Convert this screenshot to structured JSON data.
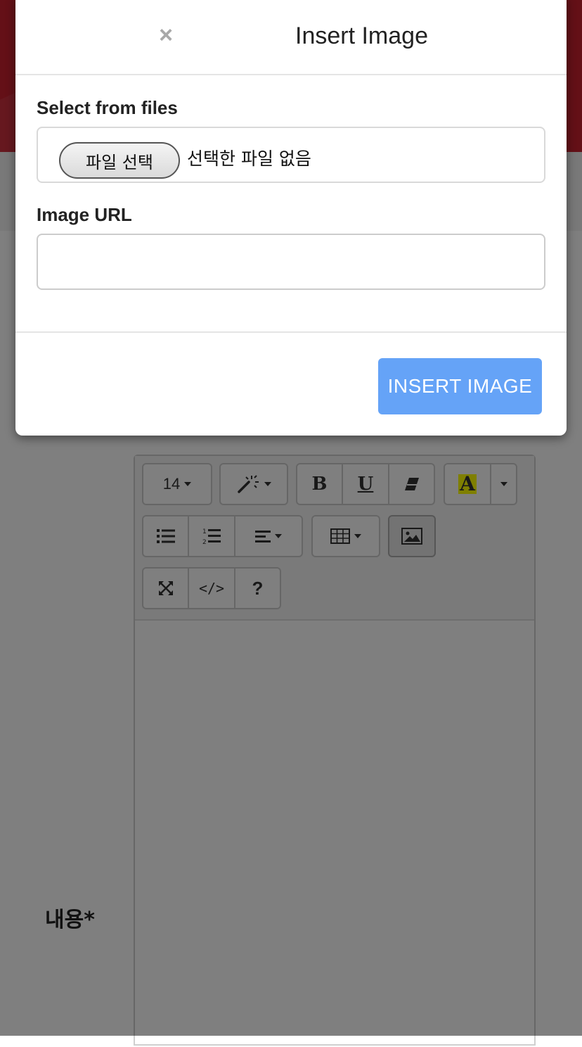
{
  "page": {
    "content_label": "내용*"
  },
  "editor": {
    "font_size": "14",
    "bold_label": "B",
    "underline_label": "U",
    "highlight_label": "A",
    "code_view_label": "</>",
    "help_label": "?"
  },
  "modal": {
    "title": "Insert Image",
    "close_label": "×",
    "file_label": "Select from files",
    "file_choose_label": "파일 선택",
    "file_status": "선택한 파일 없음",
    "url_label": "Image URL",
    "url_value": "",
    "insert_button_label": "INSERT IMAGE"
  },
  "icons": {
    "close": "close-icon",
    "magic": "magic-wand-icon",
    "eraser": "eraser-icon",
    "unordered_list": "unordered-list-icon",
    "ordered_list": "ordered-list-icon",
    "align": "align-left-icon",
    "table": "table-icon",
    "image": "image-icon",
    "fullscreen": "fullscreen-icon"
  },
  "colors": {
    "header_red": "#c8202f",
    "insert_button": "#65a3f7",
    "highlight_yellow": "#ffff00"
  }
}
